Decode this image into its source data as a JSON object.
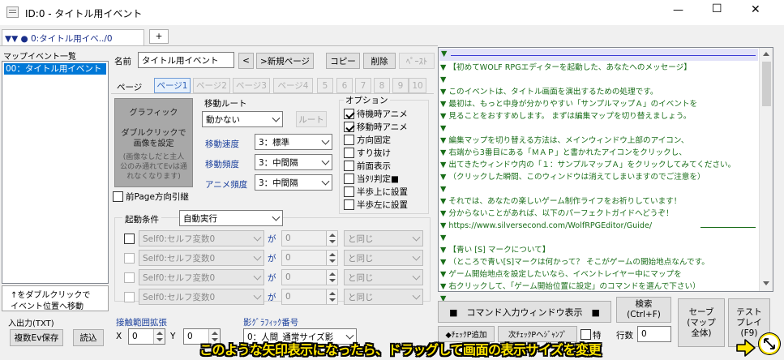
{
  "window": {
    "title": "ID:0 - タイトル用イベント",
    "minimize": "—",
    "maximize": "☐",
    "close": "✕"
  },
  "tab": {
    "label": "▼▼ ● 0:タイトル用イベ../0",
    "add": "+"
  },
  "map_events": {
    "header": "マップイベント一覧",
    "items": [
      "00：タイトル用イベント"
    ]
  },
  "hint": {
    "line1": "↑をダブルクリックで",
    "line2": "イベント位置へ移動"
  },
  "io": {
    "label": "入出力(TXT)",
    "save": "複数Ev保存",
    "load": "読込"
  },
  "name_row": {
    "label": "名前",
    "value": "タイトル用イベント",
    "prev": "<",
    "new_page": ">新規ページ",
    "copy": "コピー",
    "delete": "削除",
    "paste": "ﾍﾟｰｽﾄ"
  },
  "pages": {
    "label": "ページ",
    "tabs": [
      "ページ1",
      "ページ2",
      "ページ3",
      "ページ4",
      "5",
      "6",
      "7",
      "8",
      "9",
      "10"
    ]
  },
  "graphic": {
    "title": "グラフィック",
    "line1": "ダブルクリックで",
    "line2": "画像を設定",
    "note1": "(画像なしだと主人",
    "note2": "公のみ通れてEvは通",
    "note3": "れなくなります)"
  },
  "prev_dir": {
    "label": "前Page方向引継"
  },
  "move_route": {
    "label": "移動ルート",
    "value": "動かない",
    "route_button": "ルート",
    "speed_label": "移動速度",
    "speed": "3：標準",
    "freq_label": "移動頻度",
    "freq": "3：中間隔",
    "anim_label": "アニメ頻度",
    "anim": "3：中間隔"
  },
  "options": {
    "label": "オプション",
    "items": [
      {
        "text": "待機時アニメ",
        "checked": true
      },
      {
        "text": "移動時アニメ",
        "checked": true
      },
      {
        "text": "方向固定",
        "checked": false
      },
      {
        "text": "すり抜け",
        "checked": false
      },
      {
        "text": "前面表示",
        "checked": false
      },
      {
        "text": "当ﾀﾘ判定■",
        "checked": false
      },
      {
        "text": "半歩上に設置",
        "checked": false
      },
      {
        "text": "半歩左に設置",
        "checked": false
      }
    ]
  },
  "trigger": {
    "label": "起動条件",
    "value": "自動実行",
    "conditions": [
      {
        "var": "Self0:セルフ変数0",
        "ga": "が",
        "val": "0",
        "cmp": "と同じ"
      },
      {
        "var": "Self0:セルフ変数0",
        "ga": "が",
        "val": "0",
        "cmp": "と同じ"
      },
      {
        "var": "Self0:セルフ変数0",
        "ga": "が",
        "val": "0",
        "cmp": "と同じ"
      },
      {
        "var": "Self0:セルフ変数0",
        "ga": "が",
        "val": "0",
        "cmp": "と同じ"
      }
    ]
  },
  "contact": {
    "label": "接触範囲拡張",
    "x_label": "X",
    "x": "0",
    "y_label": "Y",
    "y": "0"
  },
  "shadow": {
    "label": "影ｸﾞﾗﾌｨｯｸ番号",
    "value": "0：人間_通常サイズ影"
  },
  "script": {
    "lines": [
      {
        "t": "▼ 【初めてWOLF RPGエディターを起動した、あなたへのメッセージ】"
      },
      {
        "t": "▼"
      },
      {
        "t": "▼    このイベントは、タイトル画面を演出するための処理です。"
      },
      {
        "t": "▼    最初は、もっと中身が分かりやすい「サンプルマップＡ」のイベントを"
      },
      {
        "t": "▼    見ることをおすすめします。 まずは編集マップを切り替えましょう。"
      },
      {
        "t": "▼"
      },
      {
        "t": "▼    編集マップを切り替える方法は、メインウィンドウ上部のアイコン、"
      },
      {
        "t": "▼    右端から3番目にある「ＭＡＰ」と書かれたアイコンをクリックし、"
      },
      {
        "t": "▼    出てきたウィンドウ内の「１：サンプルマップＡ」をクリックしてみてください。"
      },
      {
        "t": "▼      （クリックした瞬間、このウィンドウは消えてしまいますのでご注意を）"
      },
      {
        "t": "▼"
      },
      {
        "t": "▼    それでは、あなたの楽しいゲーム制作ライフをお祈りしています！"
      },
      {
        "t": "▼    分からないことがあれば、以下のパーフェクトガイドへどうぞ！"
      },
      {
        "t": "▼ https://www.silversecond.com/WolfRPGEditor/Guide/"
      },
      {
        "t": "▼"
      },
      {
        "t": "▼ 【青い [S] マークについて】"
      },
      {
        "t": "▼   （ところで青い[S]マークは何かって？ そこがゲームの開始地点なんです。"
      },
      {
        "t": "▼    ゲーム開始地点を設定したいなら、イベントレイヤー中にマップを"
      },
      {
        "t": "▼    右クリックして、「ゲーム開始位置に設定」のコマンドを選んで下さい）"
      },
      {
        "t": "▼"
      }
    ]
  },
  "cmd": {
    "input_window": "■　コマンド入力ウィンドウ表示　■",
    "search_line1": "検索",
    "search_line2": "(Ctrl+F)",
    "save_line1": "セーブ",
    "save_line2": "(マップ",
    "save_line3": "全体)",
    "test_line1": "テスト",
    "test_line2": "プレイ",
    "test_line3": "(F9)",
    "check_add": "◆ﾁｪｯｸP追加",
    "next_check": "次ﾁｪｯｸPへｼﾞｬﾝﾌﾟ",
    "special_label": "特",
    "lines_label": "行数",
    "lines_value": "0"
  },
  "overlay": {
    "text": "このような矢印表示になったら、ドラッグして画面の表示サイズを変更",
    "color": "#ffe500"
  }
}
